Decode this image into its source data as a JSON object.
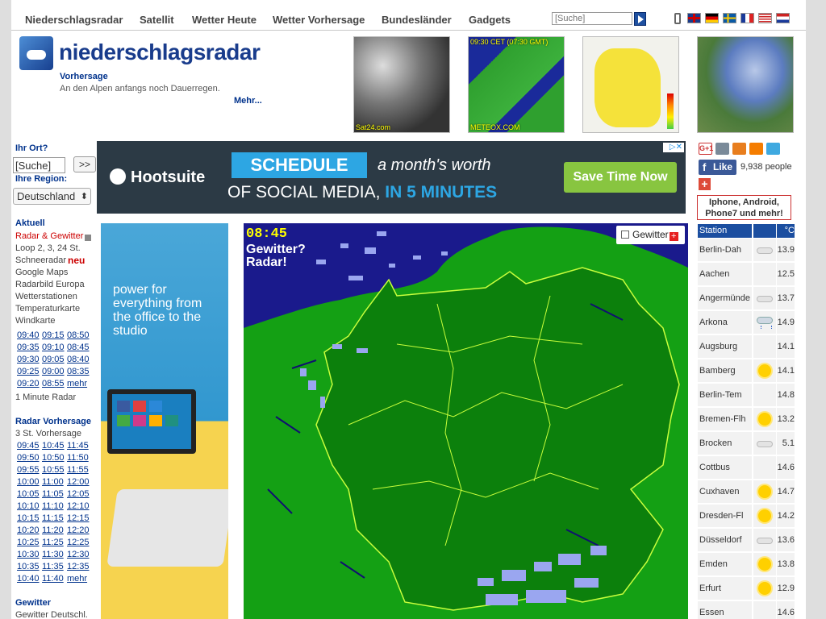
{
  "nav": {
    "items": [
      "Niederschlagsradar",
      "Satellit",
      "Wetter Heute",
      "Wetter Vorhersage",
      "Bundesländer",
      "Gadgets"
    ],
    "search_placeholder": "[Suche]"
  },
  "header": {
    "logo": "niederschlagsradar",
    "forecast_title": "Vorhersage",
    "forecast_text": "An den Alpen anfangs noch Dauerregen.",
    "more_link": "Mehr...",
    "thumbs": [
      {
        "caption": "Sat24.com"
      },
      {
        "caption_top": "09:30 CET (07:30 GMT)",
        "caption_bottom": "METEOX.COM"
      },
      {
        "caption": ""
      },
      {
        "caption": ""
      }
    ]
  },
  "sidebar": {
    "ort_label": "Ihr Ort?",
    "ort_value": "[Suche]",
    "ort_go": ">>",
    "region_label": "Ihre Region:",
    "region_value": "Deutschland",
    "aktuell_title": "Aktuell",
    "aktuell_items": [
      "Radar & Gewitter",
      "Loop 2, 3, 24 St.",
      "Schneeradar",
      "Google Maps",
      "Radarbild Europa",
      "Wetterstationen",
      "Temperaturkarte",
      "Windkarte"
    ],
    "new_badge": "neu",
    "radar_times": [
      [
        "09:40",
        "09:15",
        "08:50"
      ],
      [
        "09:35",
        "09:10",
        "08:45"
      ],
      [
        "09:30",
        "09:05",
        "08:40"
      ],
      [
        "09:25",
        "09:00",
        "08:35"
      ],
      [
        "09:20",
        "08:55",
        "mehr"
      ]
    ],
    "one_minute": "1 Minute Radar",
    "forecast_title": "Radar Vorhersage",
    "forecast_sub": "3 St. Vorhersage",
    "forecast_times": [
      [
        "09:45",
        "10:45",
        "11:45"
      ],
      [
        "09:50",
        "10:50",
        "11:50"
      ],
      [
        "09:55",
        "10:55",
        "11:55"
      ],
      [
        "10:00",
        "11:00",
        "12:00"
      ],
      [
        "10:05",
        "11:05",
        "12:05"
      ],
      [
        "10:10",
        "11:10",
        "12:10"
      ],
      [
        "10:15",
        "11:15",
        "12:15"
      ],
      [
        "10:20",
        "11:20",
        "12:20"
      ],
      [
        "10:25",
        "11:25",
        "12:25"
      ],
      [
        "10:30",
        "11:30",
        "12:30"
      ],
      [
        "10:35",
        "11:35",
        "12:35"
      ],
      [
        "10:40",
        "11:40",
        "mehr"
      ]
    ],
    "gewitter_title": "Gewitter",
    "gewitter_item": "Gewitter Deutschl."
  },
  "ad": {
    "brand": "Hootsuite",
    "ribbon": "SCHEDULE",
    "line1": "a month's worth",
    "line2a": "OF SOCIAL MEDIA,",
    "line2b": "IN 5 MINUTES",
    "cta": "Save Time Now",
    "side_text": "power for everything from the office to the studio"
  },
  "radar": {
    "time": "08:45",
    "caption_line1": "Gewitter?",
    "caption_line2": "Radar!",
    "toggle_label": "Gewitter"
  },
  "right": {
    "fb_like": "Like",
    "fb_count": "9,938 people",
    "apps_line1": "Iphone, Android,",
    "apps_line2": "Phone7 und mehr!",
    "col_station": "Station",
    "col_unit": "°C",
    "stations": [
      {
        "name": "Berlin-Dah",
        "icon": "cloud-icon",
        "temp": "13.9"
      },
      {
        "name": "Aachen",
        "icon": "none",
        "temp": "12.5"
      },
      {
        "name": "Angermünde",
        "icon": "cloud-icon",
        "temp": "13.7"
      },
      {
        "name": "Arkona",
        "icon": "rain-icon",
        "temp": "14.9"
      },
      {
        "name": "Augsburg",
        "icon": "none",
        "temp": "14.1"
      },
      {
        "name": "Bamberg",
        "icon": "sun-icon",
        "temp": "14.1"
      },
      {
        "name": "Berlin-Tem",
        "icon": "none",
        "temp": "14.8"
      },
      {
        "name": "Bremen-Flh",
        "icon": "sun-icon",
        "temp": "13.2"
      },
      {
        "name": "Brocken",
        "icon": "cloud-icon",
        "temp": "5.1"
      },
      {
        "name": "Cottbus",
        "icon": "none",
        "temp": "14.6"
      },
      {
        "name": "Cuxhaven",
        "icon": "sun-icon",
        "temp": "14.7"
      },
      {
        "name": "Dresden-Fl",
        "icon": "sun-icon",
        "temp": "14.2"
      },
      {
        "name": "Düsseldorf",
        "icon": "cloud-icon",
        "temp": "13.6"
      },
      {
        "name": "Emden",
        "icon": "sun-icon",
        "temp": "13.8"
      },
      {
        "name": "Erfurt",
        "icon": "sun-icon",
        "temp": "12.9"
      },
      {
        "name": "Essen",
        "icon": "none",
        "temp": "14.6"
      }
    ]
  }
}
